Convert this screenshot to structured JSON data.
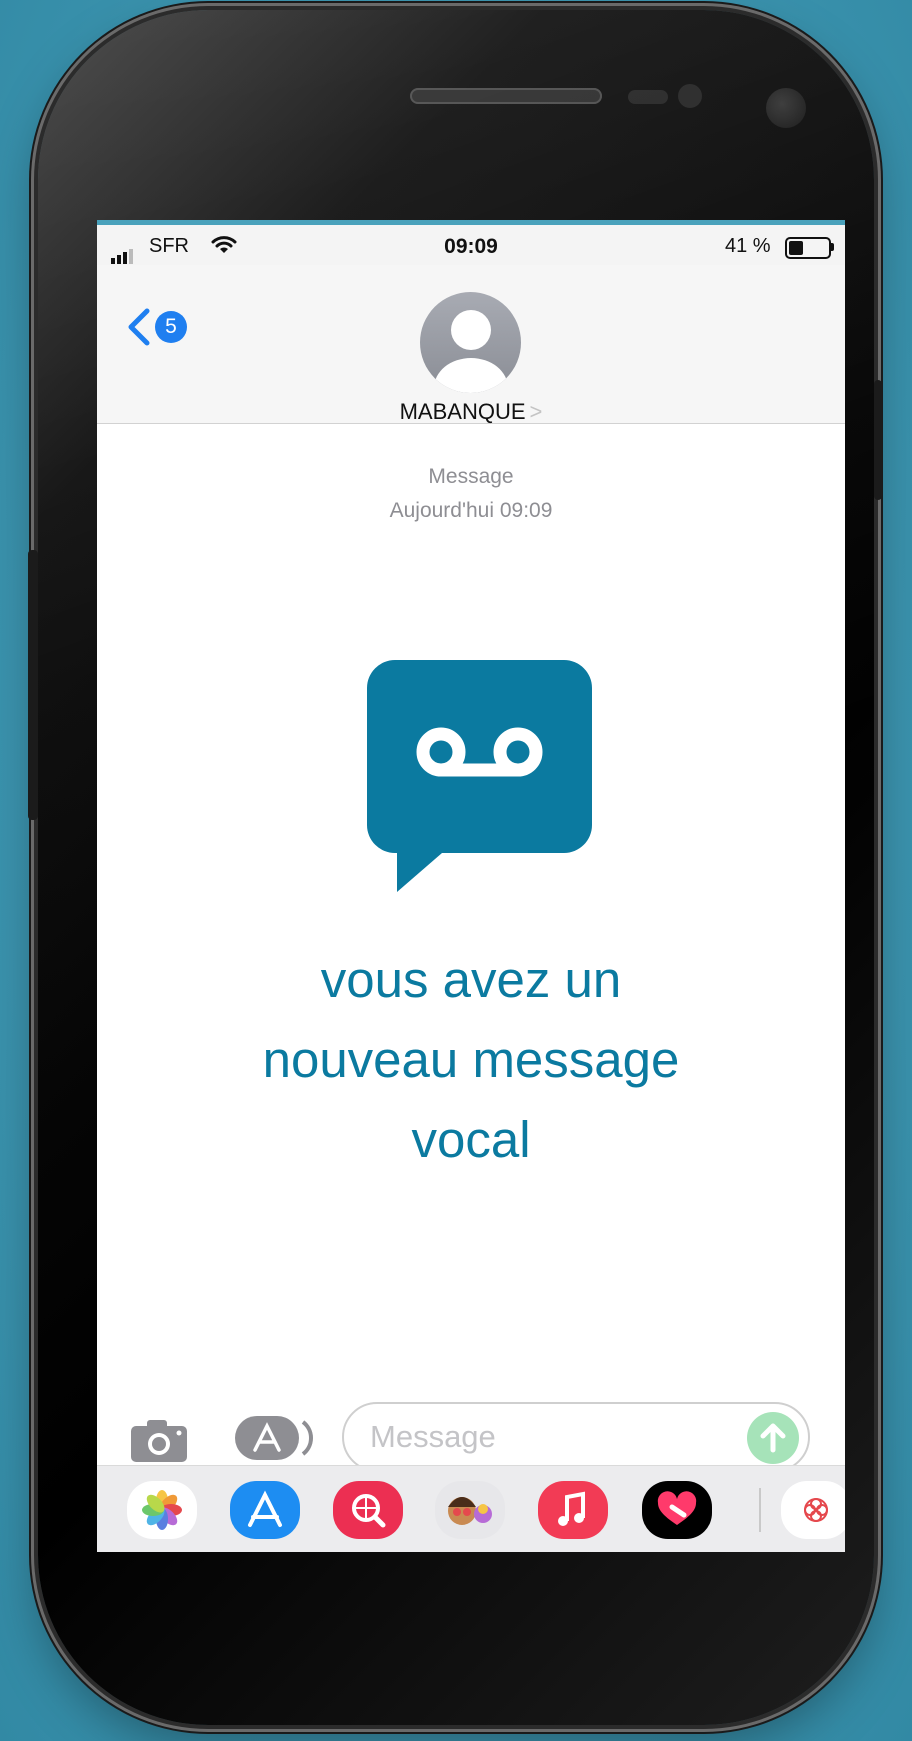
{
  "statusbar": {
    "carrier": "SFR",
    "time": "09:09",
    "battery_pct": "41 %",
    "battery_level": 0.41,
    "icons": [
      "signal-icon",
      "wifi-icon",
      "battery-icon"
    ]
  },
  "navbar": {
    "back_badge": "5",
    "contact_name": "MABANQUE",
    "contact_chevron": ">"
  },
  "conversation": {
    "message_label": "Message",
    "timestamp": "Aujourd'hui 09:09",
    "voicemail_line1": "vous avez un",
    "voicemail_line2": "nouveau message",
    "voicemail_line3": "vocal"
  },
  "input": {
    "placeholder": "Message",
    "send_icon": "arrow-up-icon"
  },
  "colors": {
    "background": "#4fa9c2",
    "voicemail_accent": "#0b7aa0",
    "ios_blue": "#1f7ff0",
    "send_green": "#a6e3b9"
  },
  "app_drawer": [
    "photos-icon",
    "app-store-icon",
    "web-search-icon",
    "memoji-icon",
    "music-icon",
    "digital-touch-icon",
    "activity-icon"
  ]
}
